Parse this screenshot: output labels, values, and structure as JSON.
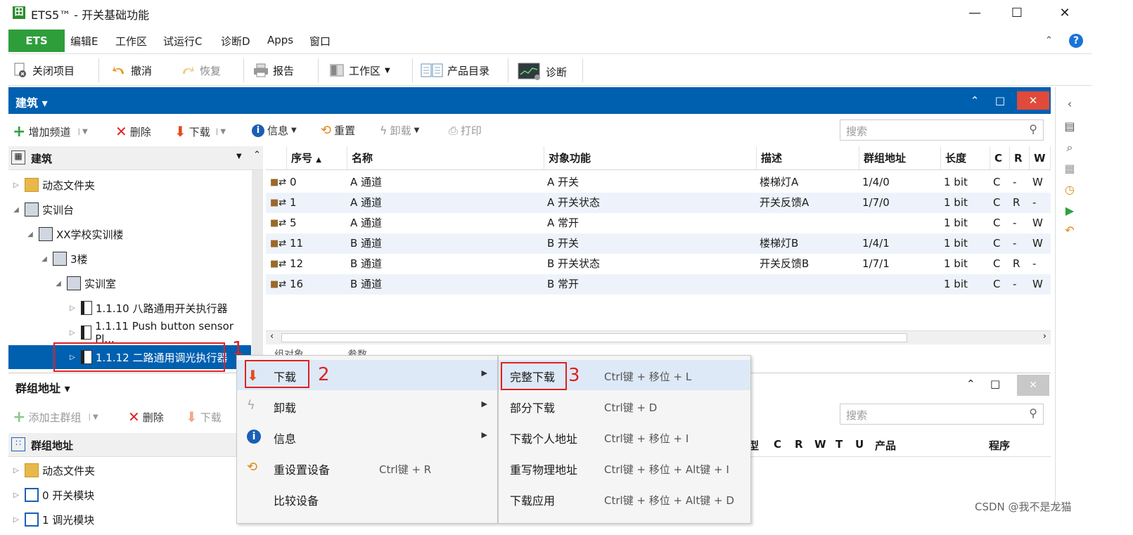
{
  "window": {
    "title": "ETS5™ - 开关基础功能",
    "min": "—",
    "max": "☐",
    "close": "✕"
  },
  "menubar": {
    "ets": "ETS",
    "items": [
      "编辑E",
      "工作区",
      "试运行C",
      "诊断D",
      "Apps",
      "窗口"
    ]
  },
  "toolbar": {
    "close_project": "关闭项目",
    "undo": "撤消",
    "redo": "恢复",
    "report": "报告",
    "workspace": "工作区",
    "catalog": "产品目录",
    "diagnostics": "诊断"
  },
  "building": {
    "header": "建筑",
    "tools": {
      "add_channel": "增加频道",
      "delete": "删除",
      "download": "下载",
      "info": "信息",
      "reset": "重置",
      "unload": "卸载",
      "print": "打印"
    },
    "search_placeholder": "搜索",
    "tree_header": "建筑",
    "tree": [
      {
        "label": "动态文件夹",
        "indent": 0,
        "expanded": false
      },
      {
        "label": "实训台",
        "indent": 0,
        "expanded": true
      },
      {
        "label": "XX学校实训楼",
        "indent": 1,
        "expanded": true
      },
      {
        "label": "3楼",
        "indent": 2,
        "expanded": true
      },
      {
        "label": "实训室",
        "indent": 3,
        "expanded": true
      },
      {
        "label": "1.1.10 八路通用开关执行器",
        "indent": 4,
        "expanded": false
      },
      {
        "label": "1.1.11 Push button sensor Pl...",
        "indent": 4,
        "expanded": false
      },
      {
        "label": "1.1.12 二路通用调光执行器",
        "indent": 4,
        "expanded": false,
        "selected": true
      }
    ]
  },
  "grid": {
    "columns": [
      "序号",
      "名称",
      "对象功能",
      "描述",
      "群组地址",
      "长度",
      "C",
      "R",
      "W"
    ],
    "rows": [
      {
        "num": "0",
        "name": "A 通道",
        "func": "A 开关",
        "desc": "楼梯灯A",
        "addr": "1/4/0",
        "len": "1 bit",
        "c": "C",
        "r": "-",
        "w": "W"
      },
      {
        "num": "1",
        "name": "A 通道",
        "func": "A 开关状态",
        "desc": "开关反馈A",
        "addr": "1/7/0",
        "len": "1 bit",
        "c": "C",
        "r": "R",
        "w": "-"
      },
      {
        "num": "5",
        "name": "A 通道",
        "func": "A 常开",
        "desc": "",
        "addr": "",
        "len": "1 bit",
        "c": "C",
        "r": "-",
        "w": "W"
      },
      {
        "num": "11",
        "name": "B 通道",
        "func": "B 开关",
        "desc": "楼梯灯B",
        "addr": "1/4/1",
        "len": "1 bit",
        "c": "C",
        "r": "-",
        "w": "W"
      },
      {
        "num": "12",
        "name": "B 通道",
        "func": "B 开关状态",
        "desc": "开关反馈B",
        "addr": "1/7/1",
        "len": "1 bit",
        "c": "C",
        "r": "R",
        "w": "-"
      },
      {
        "num": "16",
        "name": "B 通道",
        "func": "B 常开",
        "desc": "",
        "addr": "",
        "len": "1 bit",
        "c": "C",
        "r": "-",
        "w": "W"
      }
    ],
    "tabs": [
      "组对象",
      "参数"
    ]
  },
  "group": {
    "header": "群组地址",
    "tools": {
      "add_main": "添加主群组",
      "delete": "删除",
      "download": "下载"
    },
    "search_placeholder": "搜索",
    "tree_header": "群组地址",
    "tree": [
      "动态文件夹",
      "0 开关模块",
      "1 调光模块"
    ],
    "columns": [
      "型",
      "C",
      "R",
      "W",
      "T",
      "U",
      "产品",
      "程序"
    ]
  },
  "context_menu": [
    {
      "label": "下载",
      "shortcut": "",
      "submenu": true
    },
    {
      "label": "卸载",
      "shortcut": "",
      "submenu": true
    },
    {
      "label": "信息",
      "shortcut": "",
      "submenu": true
    },
    {
      "label": "重设置设备",
      "shortcut": "Ctrl键 + R",
      "submenu": false
    },
    {
      "label": "比较设备",
      "shortcut": "",
      "submenu": false
    }
  ],
  "submenu": [
    {
      "label": "完整下载",
      "shortcut": "Ctrl键 + 移位 + L"
    },
    {
      "label": "部分下载",
      "shortcut": "Ctrl键 + D"
    },
    {
      "label": "下载个人地址",
      "shortcut": "Ctrl键 + 移位 + I"
    },
    {
      "label": "重写物理地址",
      "shortcut": "Ctrl键 + 移位 + Alt键 + I"
    },
    {
      "label": "下载应用",
      "shortcut": "Ctrl键 + 移位 + Alt键 + D"
    }
  ],
  "annotations": [
    "1",
    "2",
    "3"
  ],
  "watermark": "CSDN @我不是龙猫"
}
